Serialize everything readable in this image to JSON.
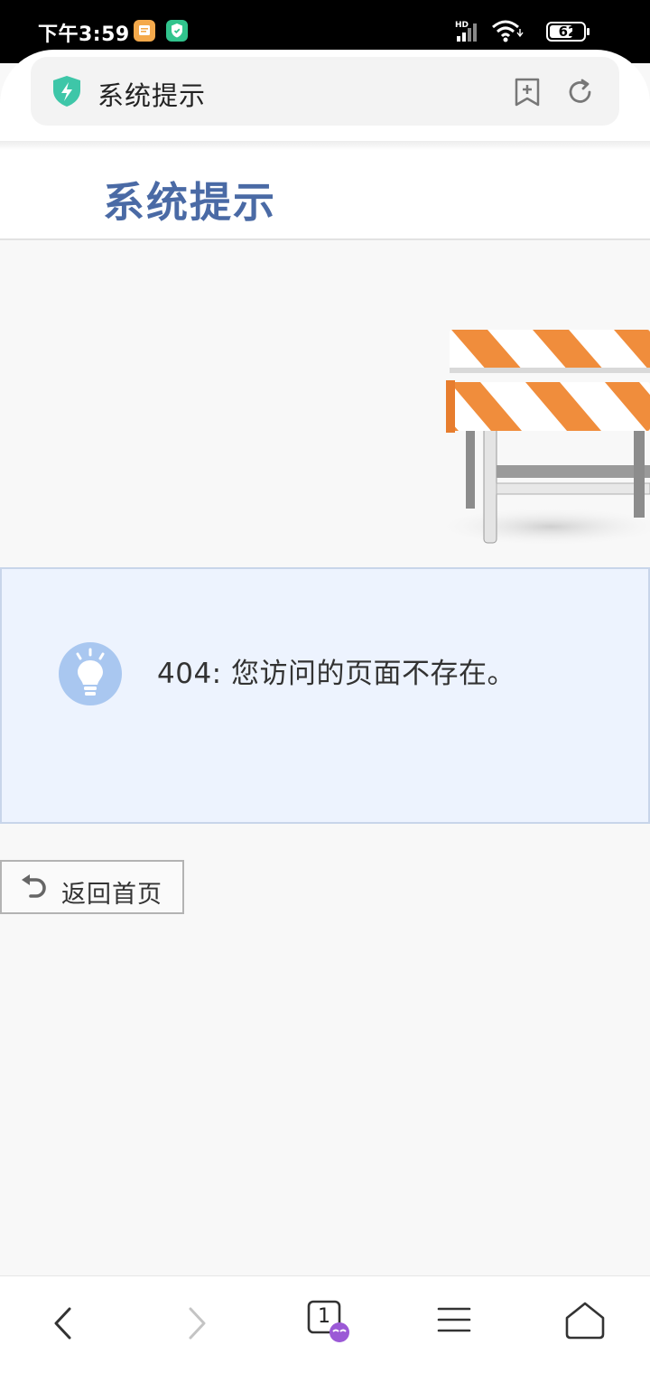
{
  "status_bar": {
    "time": "下午3:59",
    "network": "HD",
    "battery": "62"
  },
  "browser": {
    "address_title": "系统提示",
    "tab_count": "1"
  },
  "page": {
    "title": "系统提示",
    "message": "404: 您访问的页面不存在。",
    "home_button_label": "返回首页"
  },
  "colors": {
    "title_blue": "#4a6aa5",
    "message_bg": "#edf3fe",
    "barrier_orange": "#f08d3c",
    "shield_teal": "#3ec6a8"
  },
  "icons": {
    "shield": "shield-bolt-icon",
    "bookmark": "bookmark-add-icon",
    "refresh": "refresh-icon",
    "bulb": "lightbulb-icon",
    "undo": "undo-icon",
    "back": "chevron-left-icon",
    "forward": "chevron-right-icon",
    "tabs": "tabs-icon",
    "menu": "menu-icon",
    "home": "home-icon"
  }
}
